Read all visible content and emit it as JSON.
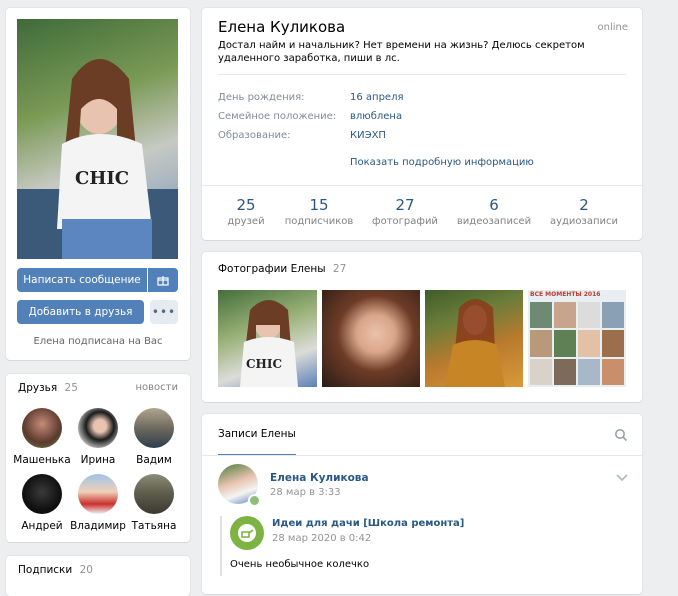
{
  "profile": {
    "name": "Елена Куликова",
    "status_online": "online",
    "bio": "Достал найм и начальник? Нет времени на жизнь? Делюсь секретом удаленного заработка, пиши в лс.",
    "info": [
      {
        "label": "День рождения:",
        "value": "16 апреля"
      },
      {
        "label": "Семейное положение:",
        "value": "влюблена"
      },
      {
        "label": "Образование:",
        "value": "КИЭХП"
      }
    ],
    "show_more": "Показать подробную информацию",
    "counters": [
      {
        "num": "25",
        "label": "друзей"
      },
      {
        "num": "15",
        "label": "подписчиков"
      },
      {
        "num": "27",
        "label": "фотографий"
      },
      {
        "num": "6",
        "label": "видеозаписей"
      },
      {
        "num": "2",
        "label": "аудиозаписи"
      }
    ]
  },
  "left": {
    "write_message": "Написать сообщение",
    "add_friend": "Добавить в друзья",
    "subscribed_note": "Елена подписана на Вас",
    "friends_title": "Друзья",
    "friends_count": "25",
    "friends_news": "новости",
    "friends": [
      "Машенька",
      "Ирина",
      "Вадим",
      "Андрей",
      "Владимир",
      "Татьяна"
    ],
    "subs_title": "Подписки",
    "subs_count": "20"
  },
  "photos": {
    "title": "Фотографии Елены",
    "count": "27",
    "collage_caption": "ВСЕ МОМЕНТЫ 2016"
  },
  "wall": {
    "tab": "Записи Елены",
    "post_author": "Елена Куликова",
    "post_date": "28 мар в 3:33",
    "repost_group": "Идеи для дачи [Школа ремонта]",
    "repost_date": "28 мар 2020 в 0:42",
    "repost_text": "Очень необычное колечко"
  },
  "colors": {
    "accent": "#5181b8",
    "link": "#2a5885",
    "bg": "#edeef0"
  }
}
